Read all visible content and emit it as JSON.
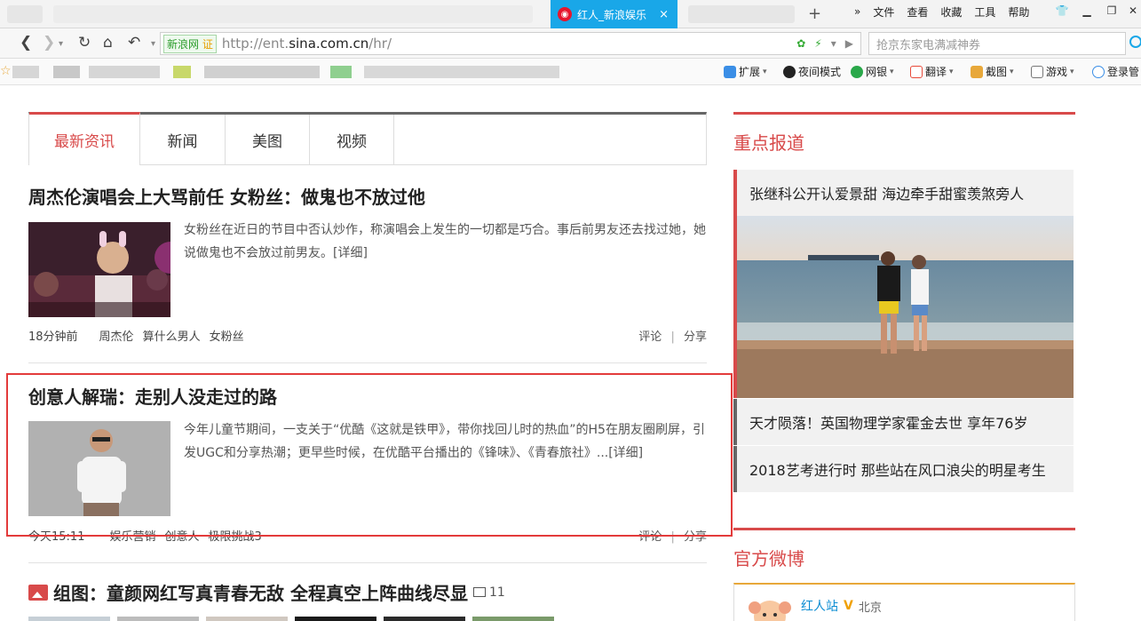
{
  "browser": {
    "active_tab_title": "红人_新浪娱乐",
    "close_glyph": "×",
    "new_tab_glyph": "+",
    "menus": [
      "文件",
      "查看",
      "收藏",
      "工具",
      "帮助"
    ],
    "chevron": "»",
    "url_badge": "新浪网",
    "url_badge_cert": "证",
    "url_prefix": "http://ent.",
    "url_domain": "sina.com.cn",
    "url_path": "/hr/",
    "search_placeholder": "抢京东家电满减神券",
    "bookmark_extensions": [
      {
        "label": "扩展",
        "color": "#3a8ee6"
      },
      {
        "label": "夜间模式",
        "color": "#222222"
      },
      {
        "label": "网银",
        "color": "#2aa84a"
      },
      {
        "label": "翻译",
        "color": "#e84a3a"
      },
      {
        "label": "截图",
        "color": "#e8a83a"
      },
      {
        "label": "游戏",
        "color": "#777777"
      },
      {
        "label": "登录管",
        "color": "#3a8ee6"
      }
    ]
  },
  "news_tabs": [
    "最新资讯",
    "新闻",
    "美图",
    "视频"
  ],
  "articles": [
    {
      "title": "周杰伦演唱会上大骂前任 女粉丝：做鬼也不放过他",
      "summary": "女粉丝在近日的节目中否认炒作，称演唱会上发生的一切都是巧合。事后前男友还去找过她，她说做鬼也不会放过前男友。[详细]",
      "time": "18分钟前",
      "tags": [
        "周杰伦",
        "算什么男人",
        "女粉丝"
      ],
      "comment": "评论",
      "share": "分享",
      "sep": "|"
    },
    {
      "title": "创意人解瑞：走别人没走过的路",
      "summary": "今年儿童节期间，一支关于“优酷《这就是铁甲》，带你找回儿时的热血”的H5在朋友圈刷屏，引发UGC和分享热潮；更早些时候，在优酷平台播出的《锋味》、《青春旅社》...[详细]",
      "time": "今天15:11",
      "tags": [
        "娱乐营销",
        "创意人",
        "极限挑战3"
      ],
      "comment": "评论",
      "share": "分享",
      "sep": "|"
    }
  ],
  "gallery": {
    "title": "组图：童颜网红写真青春无敌 全程真空上阵曲线尽显",
    "count": "11"
  },
  "sidebar": {
    "focus_heading": "重点报道",
    "focus_items": [
      "张继科公开认爱景甜 海边牵手甜蜜羡煞旁人",
      "天才陨落！英国物理学家霍金去世 享年76岁",
      "2018艺考进行时 那些站在风口浪尖的明星考生"
    ],
    "weibo_heading": "官方微博",
    "weibo_name": "红人站",
    "weibo_v": "V",
    "weibo_location": "北京"
  }
}
